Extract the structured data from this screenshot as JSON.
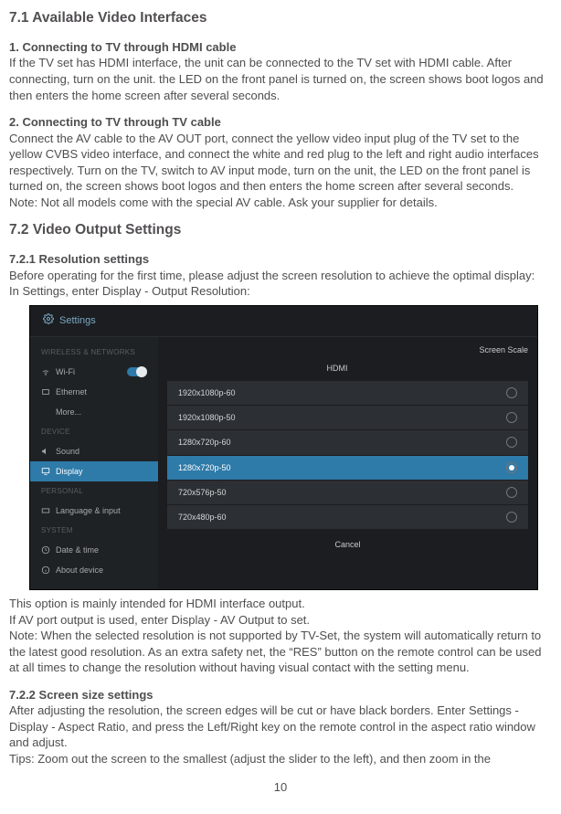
{
  "section71": {
    "title": "7.1 Available Video Interfaces",
    "s1_title": "1. Connecting to TV through HDMI cable",
    "s1_body": "If the TV set has HDMI interface, the unit can be connected to the TV set with HDMI cable. After connecting, turn on the unit. the LED on the front panel is turned on, the screen shows boot logos and then enters the home screen after several seconds.",
    "s2_title": "2. Connecting to TV through TV cable",
    "s2_body": "Connect the AV cable to the AV OUT port, connect the yellow video input plug of the TV set to the yellow CVBS video interface, and connect the white and red plug to the left and right audio interfaces respectively. Turn on the TV, switch to AV input mode, turn on the unit, the LED on the front panel is turned on, the screen shows boot logos and then enters the home screen after several seconds.",
    "s2_note": "Note: Not all models come with the special AV cable. Ask your supplier for details."
  },
  "section72": {
    "title": "7.2 Video Output Settings",
    "s1_title": "7.2.1 Resolution settings",
    "s1_line1": "Before operating for the first time, please adjust the screen resolution to achieve the optimal display:",
    "s1_line2": "In Settings, enter Display - Output Resolution:",
    "after_img_1": "This option is mainly intended for HDMI interface output.",
    "after_img_2": "If AV port output is used, enter Display - AV Output to set.",
    "after_img_3": "Note: When the selected resolution is not supported by TV-Set, the system will automatically return to the latest good resolution. As an extra safety net, the “RES” button on the remote control can be used at all times to change the resolution without having visual contact with the setting menu.",
    "s2_title": "7.2.2 Screen size settings",
    "s2_body": "After adjusting the resolution, the screen edges will be cut or have black borders. Enter Settings - Display - Aspect Ratio, and press the Left/Right key on the remote control in the aspect ratio window and adjust.",
    "s2_tip": "Tips: Zoom out the screen to the smallest (adjust the slider to the left), and then zoom in the"
  },
  "screenshot": {
    "header_title": "Settings",
    "sections": {
      "wireless": "WIRELESS & NETWORKS",
      "device": "DEVICE",
      "personal": "PERSONAL",
      "system": "SYSTEM"
    },
    "nav": {
      "wifi": "Wi-Fi",
      "ethernet": "Ethernet",
      "more": "More...",
      "sound": "Sound",
      "display": "Display",
      "language": "Language & input",
      "date": "Date & time",
      "about": "About device"
    },
    "top": {
      "screen_scale": "Screen Scale",
      "hdmi": "HDMI"
    },
    "resolutions": [
      "1920x1080p-60",
      "1920x1080p-50",
      "1280x720p-60",
      "1280x720p-50",
      "720x576p-50",
      "720x480p-60"
    ],
    "selected_index": 3,
    "cancel": "Cancel"
  },
  "page_number": "10"
}
